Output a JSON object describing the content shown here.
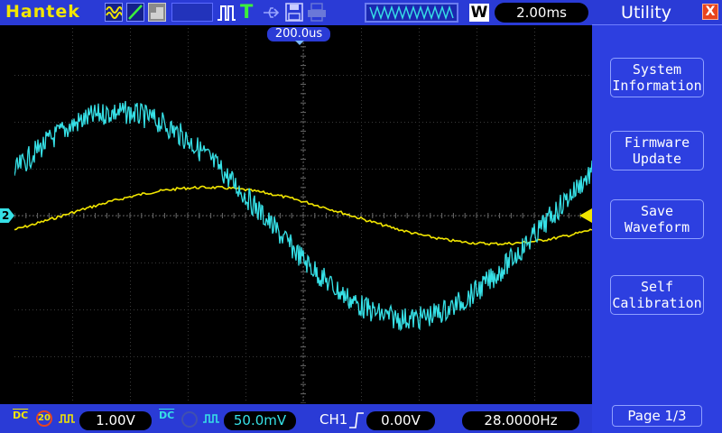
{
  "brand": "Hantek",
  "colors": {
    "ch1": "#f2e600",
    "ch2": "#36e0e6",
    "bar": "#2a3bd6",
    "panel": "#2d3fe0"
  },
  "toolbar": {
    "icons": [
      "sine-wave-icon",
      "ramp-icon",
      "grey-pattern-icon",
      "pulse-icon",
      "trigger-t-icon",
      "usb-icon",
      "save-disk-icon",
      "printer-icon"
    ],
    "trigger_symbol": "T"
  },
  "timebase": {
    "mode_badge": "W",
    "value": "2.00ms"
  },
  "trigger_position": "200.0us",
  "ch2_marker": "2",
  "panel": {
    "title": "Utility",
    "close_symbol": "X",
    "buttons": [
      {
        "label": "System\nInformation"
      },
      {
        "label": "Firmware\nUpdate"
      },
      {
        "label": "Save\nWaveform"
      },
      {
        "label": "Self\nCalibration"
      }
    ],
    "page": "Page 1/3"
  },
  "bottom": {
    "ch1_coupling": "DC",
    "ch1_bw_limit": "20",
    "ch1_scale": "1.00V",
    "ch2_coupling": "DC",
    "ch2_scale": "50.0mV",
    "trigger_source": "CH1",
    "trigger_level": "0.00V",
    "frequency": "28.0000Hz"
  },
  "waveforms": {
    "ch1": {
      "amplitude_div": 0.6,
      "phase_deg": -30
    },
    "ch2": {
      "amplitude_div": 2.2,
      "phase_deg": 25
    }
  }
}
